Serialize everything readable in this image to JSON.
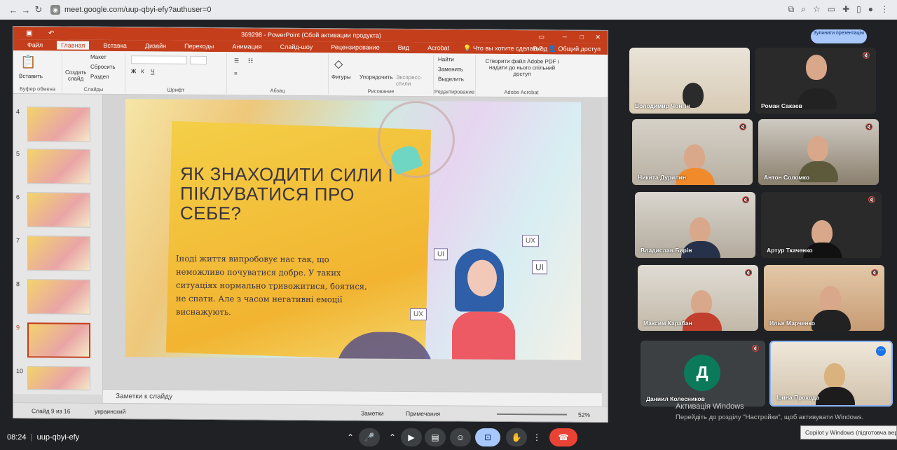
{
  "browser": {
    "url": "meet.google.com/uup-qbyi-efy?authuser=0",
    "back": "←",
    "forward": "→",
    "reload": "↻"
  },
  "meet": {
    "stop_presenting": "Зупинити презентацію",
    "time": "08:24",
    "meeting_code": "uup-qbyi-efy",
    "participants": [
      {
        "name": "Володимир Чонгін",
        "muted": true
      },
      {
        "name": "Роман Сакаев",
        "muted": true
      },
      {
        "name": "Никита Дурилин",
        "muted": true
      },
      {
        "name": "Антон Соломко",
        "muted": true
      },
      {
        "name": "Владислав Бирін",
        "muted": true
      },
      {
        "name": "Артур Ткаченко",
        "muted": true
      },
      {
        "name": "Максим Карабан",
        "muted": true
      },
      {
        "name": "Илья Марченко",
        "muted": true
      },
      {
        "name": "Даниил Колесников",
        "muted": true,
        "avatar_letter": "Д"
      },
      {
        "name": "Ірина Прохода",
        "muted": false
      }
    ],
    "controls": [
      "mic",
      "video",
      "captions",
      "emoji",
      "present",
      "raise-hand",
      "more",
      "end-call"
    ]
  },
  "windows": {
    "activation_title": "Активація Windows",
    "activation_sub": "Перейдіть до розділу \"Настройки\", щоб активувати Windows.",
    "copilot": "Copilot у Windows (підготовча версія)"
  },
  "ppt": {
    "title": "369298 - PowerPoint (Сбой активации продукта)",
    "login": "Вход",
    "share": "Общий доступ",
    "tabs": [
      "Файл",
      "Главная",
      "Вставка",
      "Дизайн",
      "Переходы",
      "Анимация",
      "Слайд-шоу",
      "Рецензирование",
      "Вид",
      "Acrobat"
    ],
    "tell_me": "Что вы хотите сделать?",
    "ribbon": {
      "paste": "Вставить",
      "clipboard": "Буфер обмена",
      "create_slide": "Создать слайд",
      "layout": "Макет",
      "reset": "Сбросить",
      "section": "Раздел",
      "slides": "Слайды",
      "font": "Шрифт",
      "paragraph": "Абзац",
      "shapes": "Фигуры",
      "arrange": "Упорядочить",
      "express": "Экспресс-стили",
      "drawing": "Рисование",
      "find": "Найти",
      "replace": "Заменить",
      "select": "Выделить",
      "editing": "Редактирование",
      "adobe": "Створити файл Adobe PDF і надати до нього спільний доступ",
      "adobe_group": "Adobe Acrobat"
    },
    "thumb_numbers": [
      "4",
      "5",
      "6",
      "7",
      "8",
      "9",
      "10"
    ],
    "slide": {
      "title": "ЯК ЗНАХОДИТИ СИЛИ І ПІКЛУВАТИСЯ ПРО СЕБЕ?",
      "body": "Іноді життя випробовує нас так, що неможливо почуватися добре. У таких ситуаціях нормально тривожитися, боятися, не спати. Але з часом негативні емоції виснажують.",
      "labels": [
        "UI",
        "UX",
        "UI",
        "UX"
      ]
    },
    "notes": "Заметки к слайду",
    "status": {
      "slide_count": "Слайд 9 из 16",
      "language": "украинский",
      "notes_btn": "Заметки",
      "comments_btn": "Примечания",
      "zoom": "52%"
    }
  }
}
